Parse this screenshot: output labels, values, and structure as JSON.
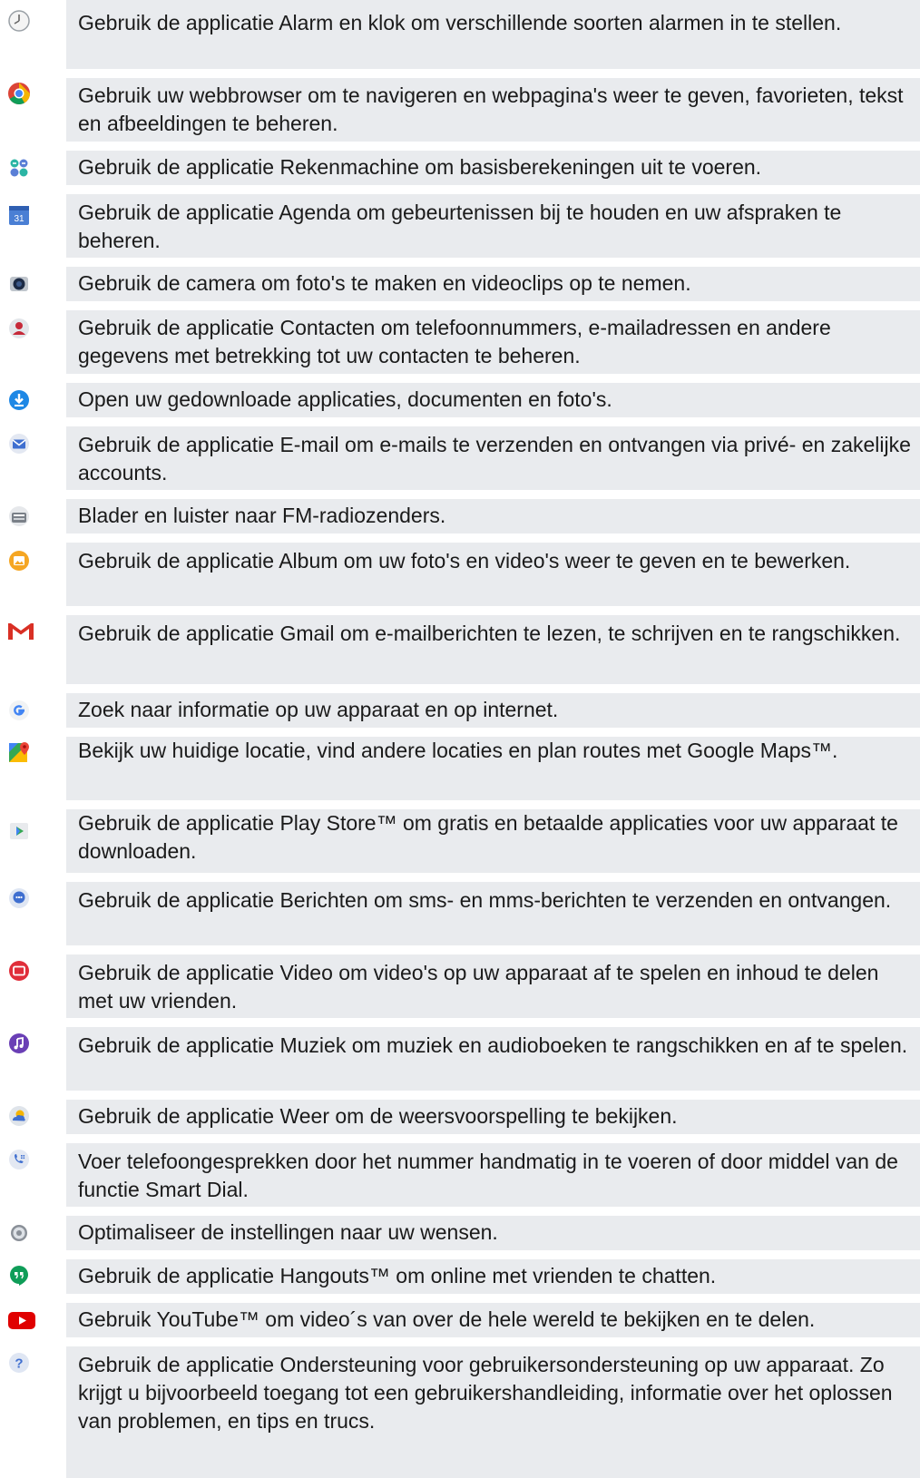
{
  "rows": [
    {
      "icon": "clock-icon",
      "text": "Gebruik de applicatie Alarm en klok om verschillende soorten alarmen in te stellen."
    },
    {
      "icon": "chrome-icon",
      "text": "Gebruik uw webbrowser om te navigeren en webpagina's weer te geven, favorieten, tekst en afbeeldingen te beheren."
    },
    {
      "icon": "calculator-icon",
      "text": "Gebruik de applicatie Rekenmachine om basisberekeningen uit te voeren."
    },
    {
      "icon": "calendar-icon",
      "text": "Gebruik de applicatie Agenda om gebeurtenissen bij te houden en uw afspraken te beheren.",
      "icon_label": "31"
    },
    {
      "icon": "camera-icon",
      "text": "Gebruik de camera om foto's te maken en videoclips op te nemen."
    },
    {
      "icon": "contacts-icon",
      "text": "Gebruik de applicatie Contacten om telefoonnummers, e-mailadressen en andere gegevens met betrekking tot uw contacten te beheren."
    },
    {
      "icon": "download-icon",
      "text": "Open uw gedownloade applicaties, documenten en foto's."
    },
    {
      "icon": "email-icon",
      "text": "Gebruik de applicatie E-mail om e-mails te verzenden en ontvangen via privé- en zakelijke accounts."
    },
    {
      "icon": "fm-radio-icon",
      "text": "Blader en luister naar FM-radiozenders."
    },
    {
      "icon": "album-icon",
      "text": "Gebruik de applicatie Album om uw foto's en video's weer te geven en te bewerken."
    },
    {
      "icon": "gmail-icon",
      "text": "Gebruik de applicatie Gmail om e-mailberichten te lezen, te schrijven en te rangschikken."
    },
    {
      "icon": "google-icon",
      "text": "Zoek naar informatie op uw apparaat en op internet."
    },
    {
      "icon": "maps-icon",
      "text": "Bekijk uw huidige locatie, vind andere locaties en plan routes met Google Maps™."
    },
    {
      "icon": "play-store-icon",
      "text": "Gebruik de applicatie Play Store™ om gratis en betaalde applicaties voor uw apparaat te downloaden."
    },
    {
      "icon": "messaging-icon",
      "text": "Gebruik de applicatie Berichten om sms- en mms-berichten te verzenden en ontvangen."
    },
    {
      "icon": "video-icon",
      "text": "Gebruik de applicatie Video om video's op uw apparaat af te spelen en inhoud te delen met uw vrienden."
    },
    {
      "icon": "music-icon",
      "text": "Gebruik de applicatie Muziek om muziek en audioboeken te rangschikken en af te spelen."
    },
    {
      "icon": "weather-icon",
      "text": "Gebruik de applicatie Weer om de weersvoorspelling te bekijken."
    },
    {
      "icon": "phone-icon",
      "text": "Voer telefoongesprekken door het nummer handmatig in te voeren of door middel van de functie Smart Dial."
    },
    {
      "icon": "settings-icon",
      "text": "Optimaliseer de instellingen naar uw wensen."
    },
    {
      "icon": "hangouts-icon",
      "text": "Gebruik de applicatie Hangouts™ om online met vrienden te chatten."
    },
    {
      "icon": "youtube-icon",
      "text": "Gebruik YouTube™ om video´s van over de hele wereld te bekijken en te delen."
    },
    {
      "icon": "support-icon",
      "text": "Gebruik de applicatie Ondersteuning voor gebruikersondersteuning op uw apparaat. Zo krijgt u bijvoorbeeld toegang tot een gebruikershandleiding, informatie over het oplossen van problemen, en tips en trucs.",
      "icon_label": "?"
    }
  ]
}
